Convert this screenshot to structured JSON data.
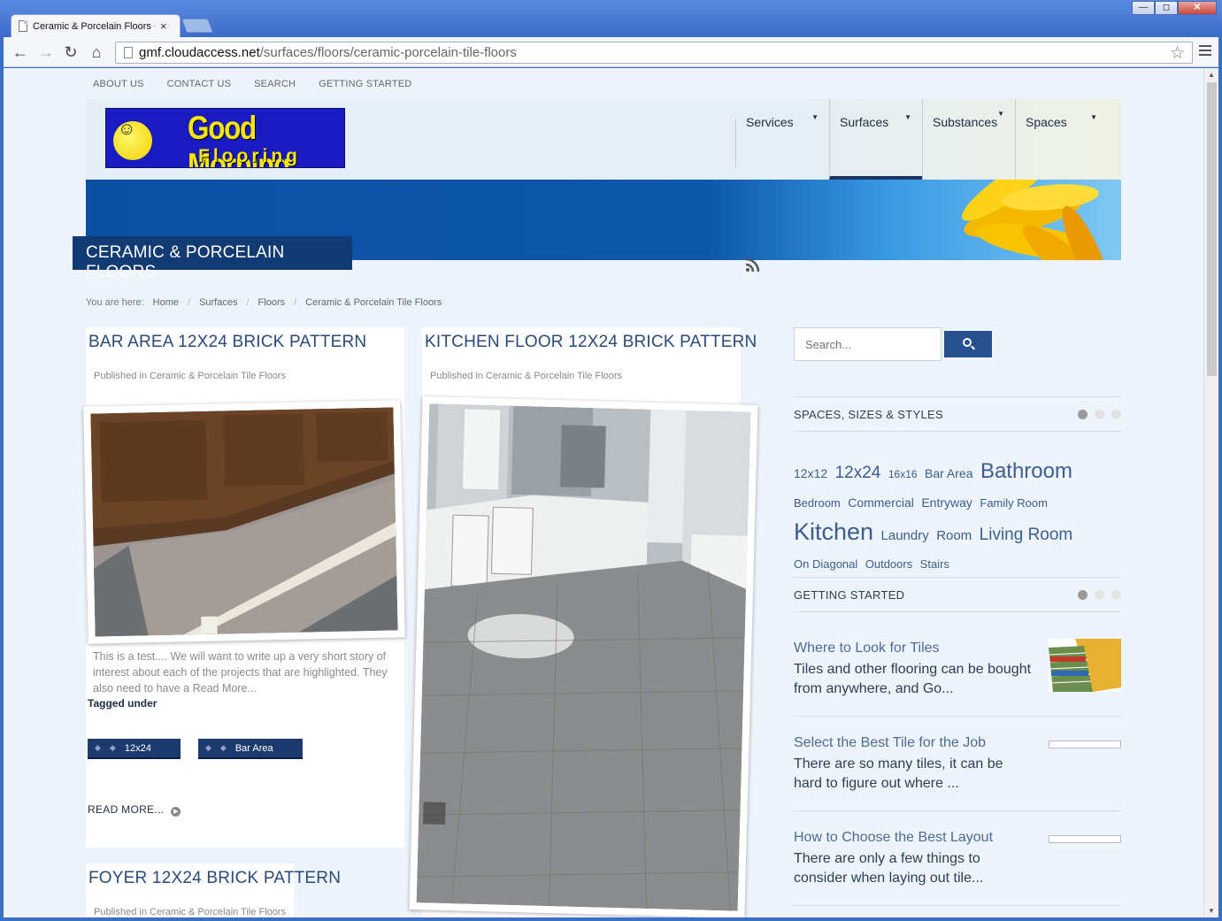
{
  "browser": {
    "tab_title": "Ceramic & Porcelain Floors - ",
    "tab_close": "×",
    "window_min": "—",
    "window_max": "◻",
    "window_close": "✕",
    "url_host": "gmf.cloudaccess.net",
    "url_path": "/surfaces/floors/ceramic-porcelain-tile-floors"
  },
  "topnav": [
    "ABOUT US",
    "CONTACT US",
    "SEARCH",
    "GETTING STARTED"
  ],
  "logo": {
    "line1": "Good Morning",
    "line2": "Flooring"
  },
  "mainnav": [
    {
      "label": "Services"
    },
    {
      "label": "Surfaces"
    },
    {
      "label": "Substances"
    },
    {
      "label": "Spaces"
    }
  ],
  "page_heading": "CERAMIC & PORCELAIN FLOORS",
  "breadcrumb": {
    "prefix": "You are here:",
    "items": [
      "Home",
      "Surfaces",
      "Floors",
      "Ceramic & Porcelain Tile Floors"
    ]
  },
  "articles": [
    {
      "title": "BAR AREA 12X24 BRICK PATTERN",
      "meta_prefix": "Published in",
      "category": "Ceramic & Porcelain Tile Floors",
      "excerpt": "This is a test.... We will want to write up a very short story of interest about each of the projects that are highlighted. They also need to have a Read More...",
      "tagged_label": "Tagged under",
      "tags": [
        "12x24",
        "Bar Area"
      ],
      "read_more": "READ MORE..."
    },
    {
      "title": "KITCHEN FLOOR 12X24 BRICK PATTERN",
      "meta_prefix": "Published in",
      "category": "Ceramic & Porcelain Tile Floors"
    },
    {
      "title": "FOYER 12X24 BRICK PATTERN",
      "meta_prefix": "Published in",
      "category": "Ceramic & Porcelain Tile Floors"
    }
  ],
  "sidebar": {
    "search_placeholder": "Search...",
    "modules": [
      "SPACES, SIZES & STYLES",
      "GETTING STARTED"
    ],
    "tags": [
      {
        "t": "12x12",
        "s": 14
      },
      {
        "t": "12x24",
        "s": 19
      },
      {
        "t": "16x16",
        "s": 12
      },
      {
        "t": "Bar Area",
        "s": 14
      },
      {
        "t": "Bathroom",
        "s": 24
      },
      {
        "t": "Bedroom",
        "s": 13
      },
      {
        "t": "Commercial",
        "s": 14
      },
      {
        "t": "Entryway",
        "s": 14
      },
      {
        "t": "Family Room",
        "s": 13
      },
      {
        "t": "Kitchen",
        "s": 27
      },
      {
        "t": "Laundry",
        "s": 15
      },
      {
        "t": "Room",
        "s": 15
      },
      {
        "t": "Living Room",
        "s": 19
      },
      {
        "t": "On Diagonal",
        "s": 13
      },
      {
        "t": "Outdoors",
        "s": 13
      },
      {
        "t": "Stairs",
        "s": 13
      }
    ],
    "getting_started": [
      {
        "title": "Where to Look for Tiles",
        "text": "Tiles and other flooring can be bought from anywhere, and Go..."
      },
      {
        "title": "Select the Best Tile for the Job",
        "text": "There are so many tiles, it can be hard to figure out where ..."
      },
      {
        "title": "How to Choose the Best Layout",
        "text": "There are only a few things to consider when laying out tile..."
      }
    ]
  }
}
